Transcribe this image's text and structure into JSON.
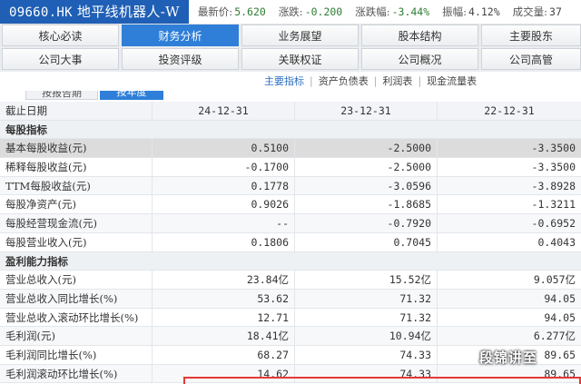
{
  "quote": {
    "code": "09660.HK",
    "name": "地平线机器人-W",
    "latest_label": "最新价:",
    "latest_value": "5.620",
    "change_label": "涨跌:",
    "change_value": "-0.200",
    "change_pct_label": "涨跌幅:",
    "change_pct_value": "-3.44%",
    "amplitude_label": "振幅:",
    "amplitude_value": "4.12%",
    "volume_label": "成交量:",
    "volume_value": "37",
    "down_color": "#2e7d32"
  },
  "nav": {
    "row1": [
      "核心必读",
      "财务分析",
      "业务展望",
      "股本结构",
      "主要股东"
    ],
    "row2": [
      "公司大事",
      "投资评级",
      "关联权证",
      "公司概况",
      "公司高管"
    ],
    "active": "财务分析",
    "active_color": "#2f7fd8"
  },
  "sublinks": [
    "主要指标",
    "资产负债表",
    "利润表",
    "现金流量表"
  ],
  "sublinks_sep": "|",
  "tabs": [
    "按报告期",
    "按年度"
  ],
  "table": {
    "header": [
      "截止日期",
      "24-12-31",
      "23-12-31",
      "22-12-31"
    ],
    "sections": [
      {
        "title": "每股指标",
        "rows": [
          [
            "基本每股收益(元)",
            "0.5100",
            "-2.5000",
            "-3.3500"
          ],
          [
            "稀释每股收益(元)",
            "-0.1700",
            "-2.5000",
            "-3.3500"
          ],
          [
            "TTM每股收益(元)",
            "0.1778",
            "-3.0596",
            "-3.8928"
          ],
          [
            "每股净资产(元)",
            "0.9026",
            "-1.8685",
            "-1.3211"
          ],
          [
            "每股经营现金流(元)",
            "--",
            "-0.7920",
            "-0.6952"
          ],
          [
            "每股营业收入(元)",
            "0.1806",
            "0.7045",
            "0.4043"
          ]
        ]
      },
      {
        "title": "盈利能力指标",
        "rows": [
          [
            "营业总收入(元)",
            "23.84亿",
            "15.52亿",
            "9.057亿"
          ],
          [
            "营业总收入同比增长(%)",
            "53.62",
            "71.32",
            "94.05"
          ],
          [
            "营业总收入滚动环比增长(%)",
            "12.71",
            "71.32",
            "94.05"
          ],
          [
            "毛利润(元)",
            "18.41亿",
            "10.94亿",
            "6.277亿"
          ],
          [
            "毛利润同比增长(%)",
            "68.27",
            "74.33",
            "89.65"
          ],
          [
            "毛利润滚动环比增长(%)",
            "14.62",
            "74.33",
            "89.65"
          ]
        ]
      }
    ]
  },
  "watermark": "段锦讲至"
}
